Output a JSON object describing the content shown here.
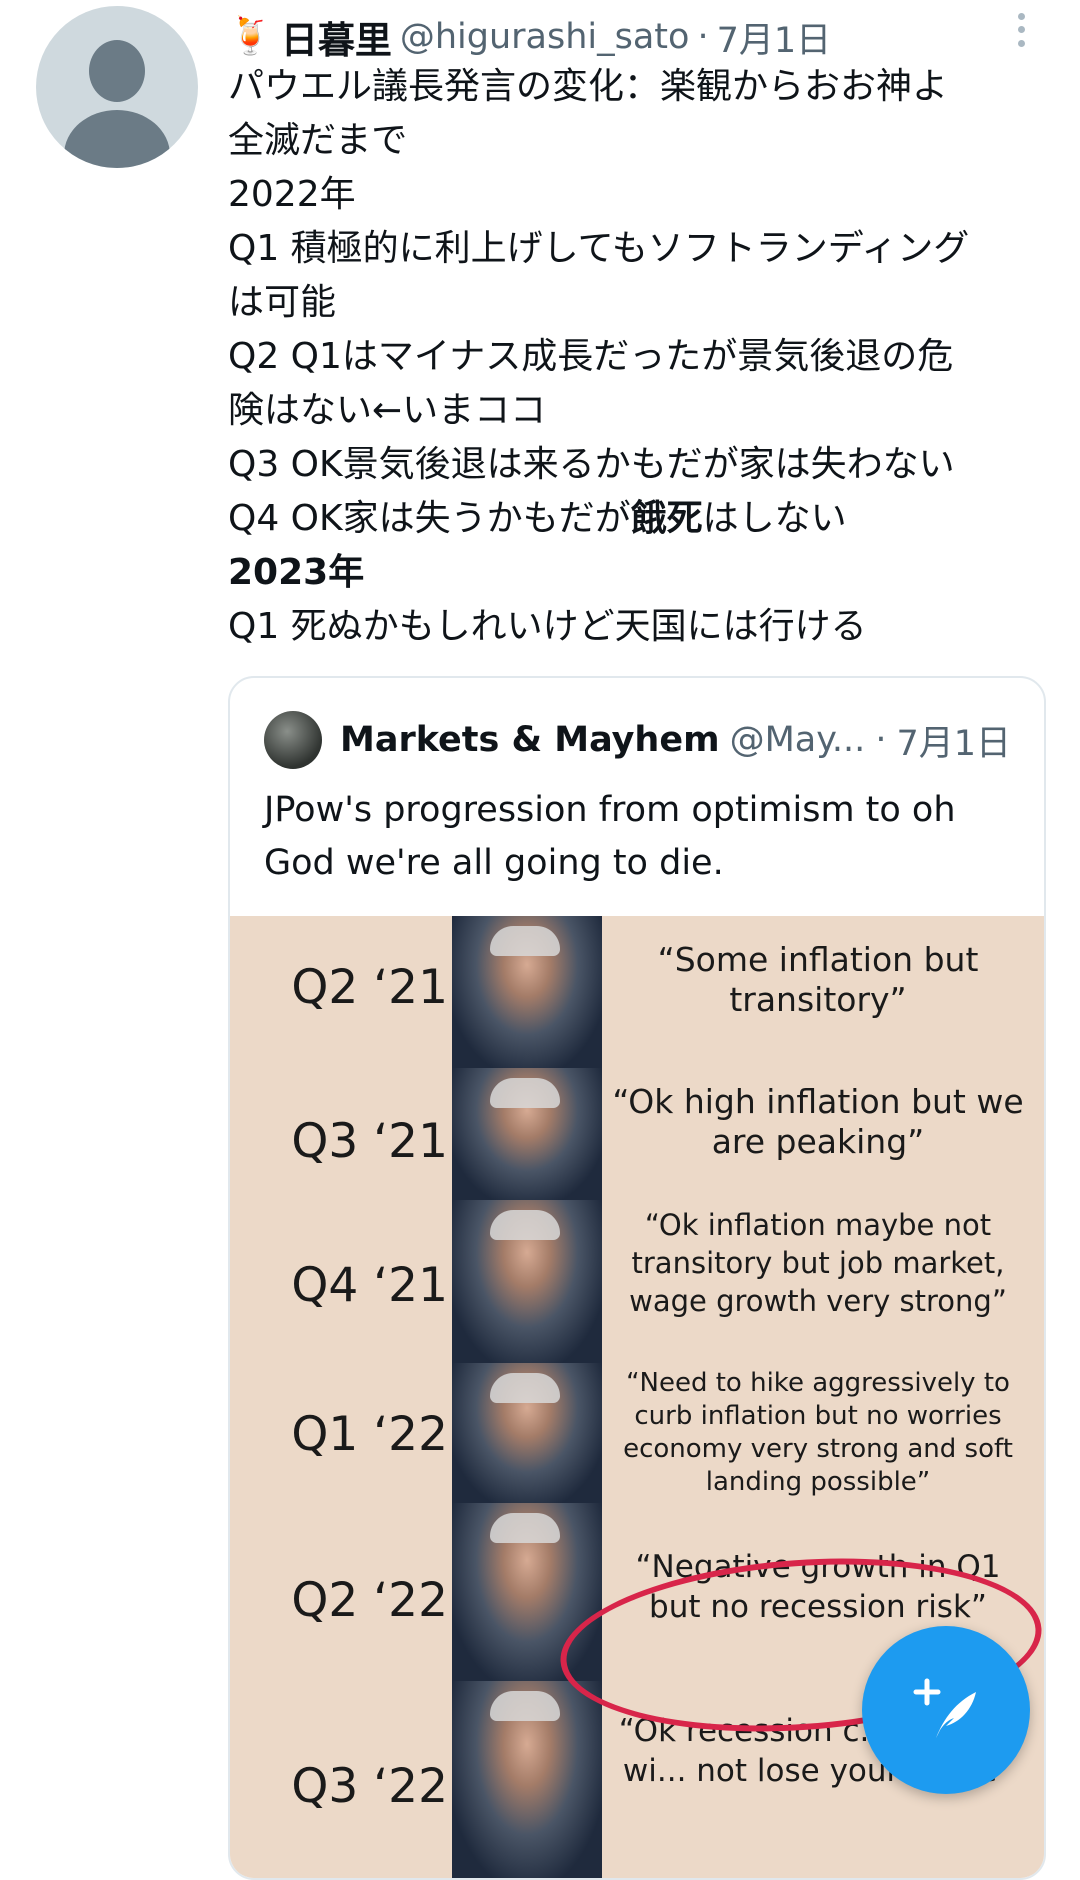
{
  "tweet": {
    "author_emoji": "🍹",
    "display_name": "日暮里",
    "handle": "@higurashi_sato",
    "separator": "·",
    "date": "7月1日",
    "lines": [
      "パウエル議長発言の変化：楽観からおお神よ",
      "全滅だまで",
      "2022年",
      "Q1 積極的に利上げしてもソフトランディング",
      "は可能",
      "Q2 Q1はマイナス成長だったが景気後退の危",
      "険はない←いまココ",
      "Q3 OK景気後退は来るかもだが家は失わない"
    ],
    "q4_pre": "Q4 OK家は失うかもだが",
    "q4_bold": "餓死",
    "q4_post": "はしない",
    "year_2023": "2023年",
    "last_line": "Q1 死ぬかもしれいけど天国には行ける"
  },
  "quote": {
    "name": "Markets & Mayhem",
    "handle": "@May...",
    "separator": "·",
    "date": "7月1日",
    "text": "JPow's progression from optimism to oh God we're all going to die."
  },
  "meme": {
    "rows": [
      {
        "q": "Q2 ‘21",
        "quote": "“Some inflation but transitory”"
      },
      {
        "q": "Q3 ‘21",
        "quote": "“Ok high inflation but we are peaking”"
      },
      {
        "q": "Q4 ‘21",
        "quote": "“Ok inflation maybe not transitory but job market, wage growth very strong”"
      },
      {
        "q": "Q1 ‘22",
        "quote": "“Need to hike aggressively to curb inflation but no worries economy very strong and soft landing possible”"
      },
      {
        "q": "Q2 ‘22",
        "quote": "“Negative growth in Q1 but no recession risk”"
      },
      {
        "q": "Q3 ‘22",
        "quote": "“Ok recession c... but you wi... not lose your home”"
      }
    ]
  },
  "fab": {
    "icon": "compose-feather-icon",
    "color": "#1d9bf0"
  },
  "colors": {
    "accent": "#1d9bf0",
    "meme_bg": "#ecd9c8",
    "circle": "#d8254a",
    "muted": "#536471"
  }
}
